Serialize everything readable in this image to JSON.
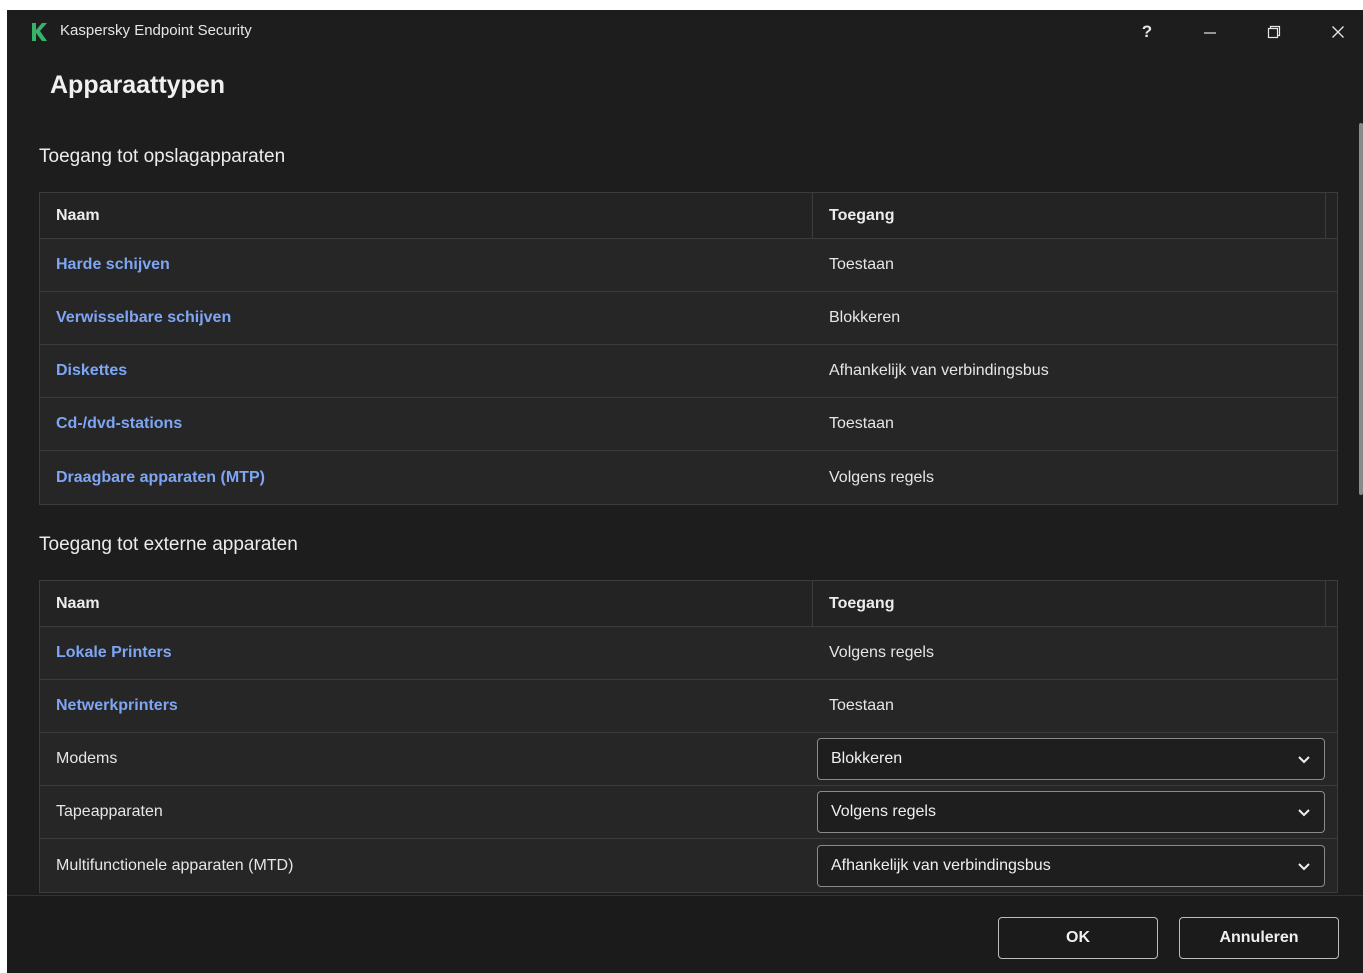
{
  "window": {
    "app_title": "Kaspersky Endpoint Security",
    "help_label": "?",
    "brand_color": "#35b36a"
  },
  "page": {
    "title": "Apparaattypen"
  },
  "storage": {
    "title": "Toegang tot opslagapparaten",
    "columns": [
      "Naam",
      "Toegang"
    ],
    "rows": [
      {
        "name": "Harde schijven",
        "access": "Toestaan"
      },
      {
        "name": "Verwisselbare schijven",
        "access": "Blokkeren"
      },
      {
        "name": "Diskettes",
        "access": "Afhankelijk van verbindingsbus"
      },
      {
        "name": "Cd-/dvd-stations",
        "access": "Toestaan"
      },
      {
        "name": "Draagbare apparaten (MTP)",
        "access": "Volgens regels"
      }
    ]
  },
  "external": {
    "title": "Toegang tot externe apparaten",
    "columns": [
      "Naam",
      "Toegang"
    ],
    "link_rows": [
      {
        "name": "Lokale Printers",
        "access": "Volgens regels"
      },
      {
        "name": "Netwerkprinters",
        "access": "Toestaan"
      }
    ],
    "select_rows": [
      {
        "name": "Modems",
        "access": "Blokkeren"
      },
      {
        "name": "Tapeapparaten",
        "access": "Volgens regels"
      },
      {
        "name": "Multifunctionele apparaten (MTD)",
        "access": "Afhankelijk van verbindingsbus"
      }
    ]
  },
  "footer": {
    "ok_label": "OK",
    "cancel_label": "Annuleren"
  }
}
